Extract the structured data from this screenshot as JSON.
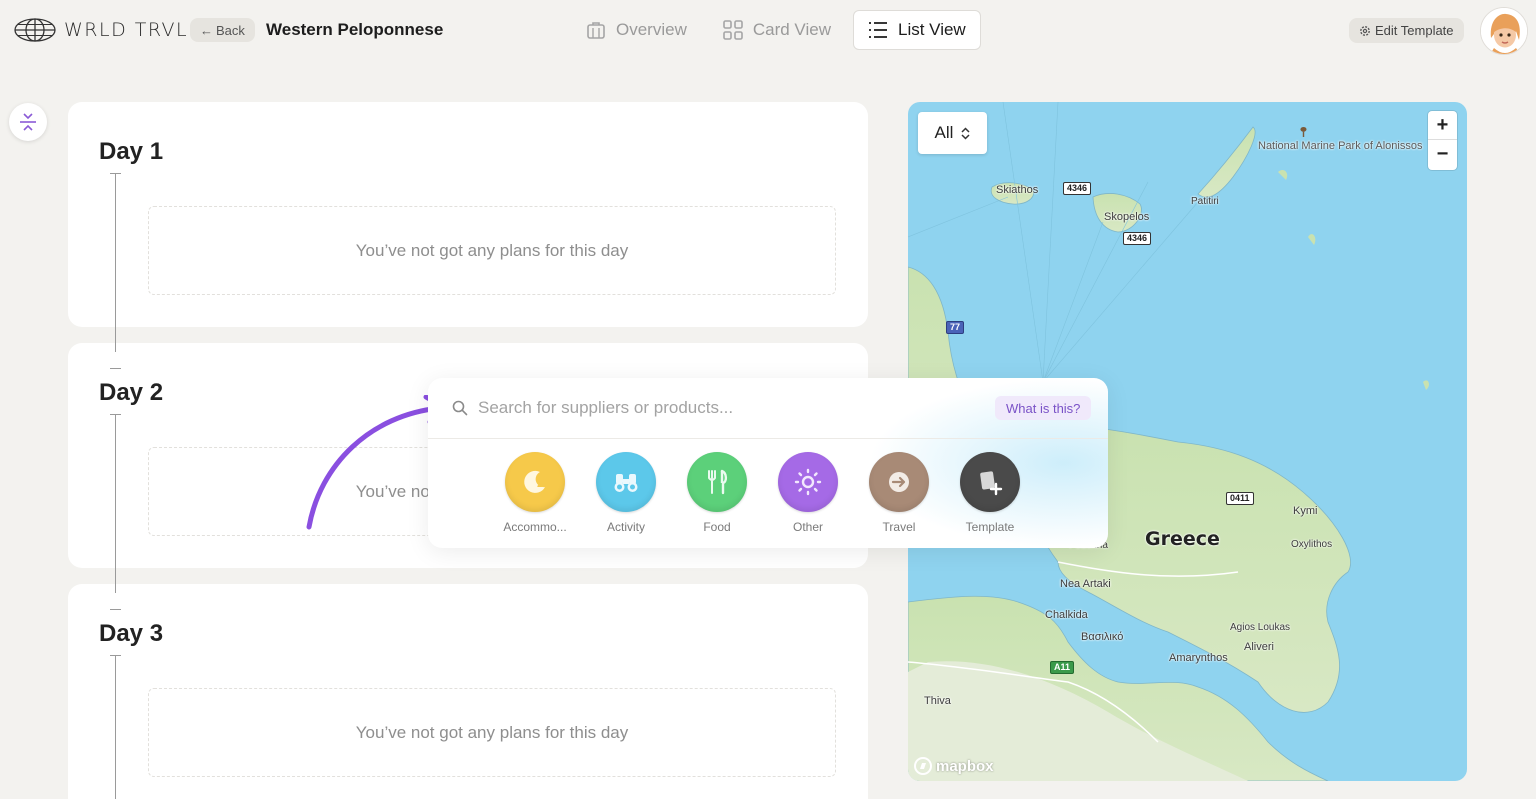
{
  "app": {
    "brand": "WRLD TRVL",
    "back_label": "Back",
    "page_title": "Western Peloponnese"
  },
  "view_tabs": [
    {
      "label": "Overview",
      "icon": "suitcase-icon",
      "active": false
    },
    {
      "label": "Card View",
      "icon": "grid-icon",
      "active": false
    },
    {
      "label": "List View",
      "icon": "list-icon",
      "active": true
    }
  ],
  "edit_template_label": "Edit Template",
  "days": [
    {
      "title": "Day 1",
      "empty_text": "You’ve not got any plans for this day"
    },
    {
      "title": "Day 2",
      "empty_text": "You’ve not got any plans for this day"
    },
    {
      "title": "Day 3",
      "empty_text": "You’ve not got any plans for this day"
    }
  ],
  "search": {
    "placeholder": "Search for suppliers or products...",
    "help_label": "What is this?",
    "categories": [
      {
        "label": "Accommo...",
        "color": "#f6c94a",
        "icon": "moon-icon"
      },
      {
        "label": "Activity",
        "color": "#5cc8ea",
        "icon": "binoculars-icon"
      },
      {
        "label": "Food",
        "color": "#5cd07a",
        "icon": "cutlery-icon"
      },
      {
        "label": "Other",
        "color": "#a56ae6",
        "icon": "sun-icon"
      },
      {
        "label": "Travel",
        "color": "#a88a76",
        "icon": "arrow-right-icon"
      },
      {
        "label": "Template",
        "color": "#4a4a4a",
        "icon": "template-add-icon"
      }
    ]
  },
  "map": {
    "filter_value": "All",
    "zoom_in": "+",
    "zoom_out": "−",
    "attribution": "mapbox",
    "labels": {
      "marine_park": "National Marine Park of Alonissos",
      "skiathos": "Skiathos",
      "skopelos": "Skopelos",
      "patitiri": "Patitiri",
      "greece": "Greece",
      "kymi": "Kymi",
      "oxylithos": "Oxylithos",
      "psachna": "Psachna",
      "nea_artaki": "Nea Artaki",
      "chalkida": "Chalkida",
      "vasiliko": "Βασιλικό",
      "agios_loukas": "Agios Loukas",
      "aliveri": "Aliveri",
      "amarynthos": "Amarynthos",
      "thiva": "Thiva"
    },
    "road_shields": {
      "r4346a": "4346",
      "r4346b": "4346",
      "r77": "77",
      "r0411": "0411",
      "a11": "A11"
    }
  }
}
